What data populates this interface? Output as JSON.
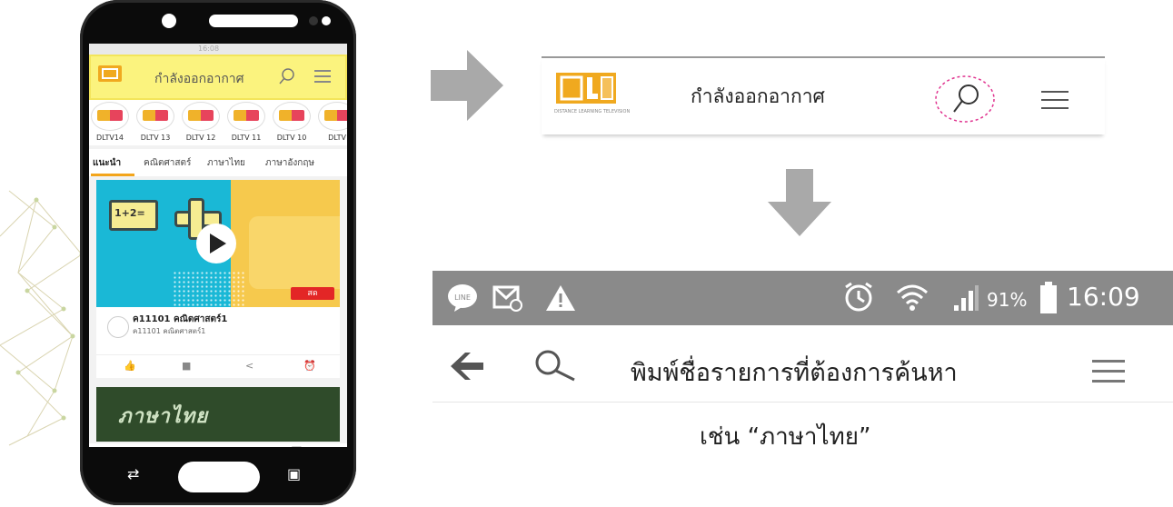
{
  "phone": {
    "status_time": "16:08",
    "app_title": "กำลังออกอากาศ",
    "channels": [
      {
        "name": "DLTV14",
        "num": "14"
      },
      {
        "name": "DLTV 13",
        "num": "13"
      },
      {
        "name": "DLTV 12",
        "num": "12"
      },
      {
        "name": "DLTV 11",
        "num": "11"
      },
      {
        "name": "DLTV 10",
        "num": "10"
      },
      {
        "name": "DLTV",
        "num": ""
      }
    ],
    "tabs": [
      "แนะนำ",
      "คณิตศาสตร์",
      "ภาษาไทย",
      "ภาษาอังกฤษ"
    ],
    "card": {
      "board_text": "1+2=",
      "live_label": "สด",
      "title": "ค11101 คณิตศาสตร์1",
      "subtitle": "ค11101 คณิตศาสตร์1"
    },
    "card2_title": "ภาษาไทย"
  },
  "zoom_header": {
    "logo_text": "DLTV",
    "logo_sub": "DISTANCE LEARNING TELEVISION",
    "title": "กำลังออกอากาศ"
  },
  "android_status": {
    "battery": "91%",
    "time": "16:09"
  },
  "search_bar": {
    "hint": "พิมพ์ชื่อรายการที่ต้องการค้นหา"
  },
  "caption": "เช่น “ภาษาไทย”",
  "colors": {
    "highlight": "#fbf37e",
    "accent_orange": "#f3a51b",
    "dashed_circle": "#e0338f",
    "arrow_gray": "#a9a9a9",
    "statusbar_gray": "#8a8a8a"
  }
}
